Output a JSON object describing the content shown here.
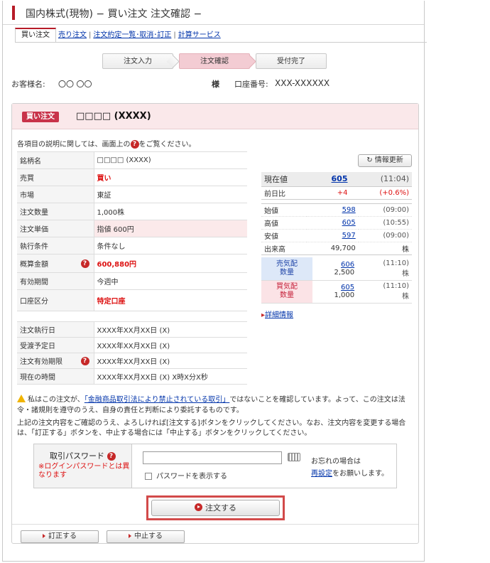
{
  "header": {
    "title": "国内株式(現物) − 買い注文 注文確認 −"
  },
  "tabs": {
    "active": "買い注文",
    "links": [
      "売り注文",
      "注文約定一覧･取消･訂正",
      "計算サービス"
    ]
  },
  "steps": [
    "注文入力",
    "注文確認",
    "受付完了"
  ],
  "customer": {
    "name_label": "お客様名:",
    "name_value": "〇〇 〇〇",
    "honorific": "様",
    "account_label": "口座番号:",
    "account_value": "XXX-XXXXXX"
  },
  "order": {
    "badge": "買い注文",
    "stock_title": "□□□□ (XXXX)",
    "help_note_pre": "各項目の説明に関しては、画面上の",
    "help_note_post": "をご覧ください。",
    "rows": [
      {
        "label": "銘柄名",
        "value": "□□□□ (XXXX)"
      },
      {
        "label": "売買",
        "value": "買い"
      },
      {
        "label": "市場",
        "value": "東証"
      },
      {
        "label": "注文数量",
        "value": "1,000株"
      },
      {
        "label": "注文単価",
        "value": "指値 600円"
      },
      {
        "label": "執行条件",
        "value": "条件なし"
      },
      {
        "label": "概算金額",
        "value": "600,880円"
      },
      {
        "label": "有効期間",
        "value": "今週中"
      },
      {
        "label": "口座区分",
        "value": "特定口座"
      }
    ],
    "dates": [
      {
        "label": "注文執行日",
        "value": "XXXX年XX月XX日 (X)"
      },
      {
        "label": "受渡予定日",
        "value": "XXXX年XX月XX日 (X)"
      },
      {
        "label": "注文有効期限",
        "value": "XXXX年XX月XX日 (X)"
      },
      {
        "label": "現在の時間",
        "value": "XXXX年XX月XX日 (X) X時X分X秒"
      }
    ]
  },
  "quote": {
    "refresh": "情報更新",
    "current": {
      "label": "現在値",
      "value": "605",
      "time": "(11:04)"
    },
    "change": {
      "label": "前日比",
      "value": "+4",
      "pct": "(+0.6%)"
    },
    "ohlc": [
      {
        "label": "始値",
        "value": "598",
        "time": "(09:00)"
      },
      {
        "label": "高値",
        "value": "605",
        "time": "(10:55)"
      },
      {
        "label": "安値",
        "value": "597",
        "time": "(09:00)"
      }
    ],
    "volume": {
      "label": "出来高",
      "value": "49,700",
      "unit": "株"
    },
    "sell": {
      "label1": "売気配",
      "label2": "数量",
      "price": "606",
      "time": "(11:10)",
      "qty": "2,500",
      "unit": "株"
    },
    "buy": {
      "label1": "買気配",
      "label2": "数量",
      "price": "605",
      "time": "(11:10)",
      "qty": "1,000",
      "unit": "株"
    },
    "detail_link": "詳細情報"
  },
  "warning": {
    "pre": "私はこの注文が、",
    "link": "「金融商品取引法により禁止されている取引」",
    "post": "ではないことを確認しています。よって、この注文は法令・諸規則を遵守のうえ、自身の責任と判断により委託するものです。"
  },
  "notice": "上記の注文内容をご確認のうえ、よろしければ[注文する]ボタンをクリックしてください。なお、注文内容を変更する場合は、「訂正する」ボタンを、中止する場合には「中止する」ボタンをクリックしてください。",
  "password": {
    "label": "取引パスワード",
    "note": "※ログインパスワードとは異なります",
    "value": "",
    "show_label": "パスワードを表示する",
    "forgot_pre": "お忘れの場合は",
    "forgot_link": "再設定",
    "forgot_post": "をお願いします。"
  },
  "buttons": {
    "order": "注文する",
    "modify": "訂正する",
    "cancel": "中止する"
  }
}
